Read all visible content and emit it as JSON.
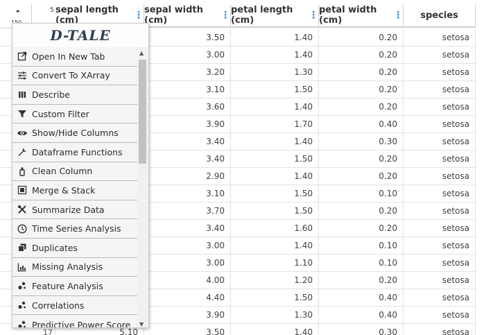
{
  "corner": {
    "play": "►",
    "cols": "5",
    "rows": "150"
  },
  "columns": [
    "sepal length (cm)",
    "sepal width (cm)",
    "petal length (cm)",
    "petal width (cm)",
    "species"
  ],
  "rows": [
    [
      "",
      "3.50",
      "1.40",
      "0.20",
      "setosa"
    ],
    [
      "",
      "3.00",
      "1.40",
      "0.20",
      "setosa"
    ],
    [
      "",
      "3.20",
      "1.30",
      "0.20",
      "setosa"
    ],
    [
      "",
      "3.10",
      "1.50",
      "0.20",
      "setosa"
    ],
    [
      "",
      "3.60",
      "1.40",
      "0.20",
      "setosa"
    ],
    [
      "",
      "3.90",
      "1.70",
      "0.40",
      "setosa"
    ],
    [
      "",
      "3.40",
      "1.40",
      "0.30",
      "setosa"
    ],
    [
      "",
      "3.40",
      "1.50",
      "0.20",
      "setosa"
    ],
    [
      "",
      "2.90",
      "1.40",
      "0.20",
      "setosa"
    ],
    [
      "",
      "3.10",
      "1.50",
      "0.10",
      "setosa"
    ],
    [
      "",
      "3.70",
      "1.50",
      "0.20",
      "setosa"
    ],
    [
      "",
      "3.40",
      "1.60",
      "0.20",
      "setosa"
    ],
    [
      "",
      "3.00",
      "1.40",
      "0.10",
      "setosa"
    ],
    [
      "",
      "3.00",
      "1.10",
      "0.10",
      "setosa"
    ],
    [
      "",
      "4.00",
      "1.20",
      "0.20",
      "setosa"
    ],
    [
      "",
      "4.40",
      "1.50",
      "0.40",
      "setosa"
    ],
    [
      "",
      "3.90",
      "1.30",
      "0.40",
      "setosa"
    ],
    [
      "5.10",
      "3.50",
      "1.40",
      "0.30",
      "setosa"
    ]
  ],
  "last_row_index": "17",
  "menu": {
    "logo": "D-TALE",
    "items": [
      {
        "label": "Open In New Tab",
        "icon": "external-link-icon"
      },
      {
        "label": "Convert To XArray",
        "icon": "sliders-icon"
      },
      {
        "label": "Describe",
        "icon": "bars-icon"
      },
      {
        "label": "Custom Filter",
        "icon": "filter-icon"
      },
      {
        "label": "Show/Hide Columns",
        "icon": "eye-icon"
      },
      {
        "label": "Dataframe Functions",
        "icon": "wrench-icon"
      },
      {
        "label": "Clean Column",
        "icon": "clean-icon"
      },
      {
        "label": "Merge & Stack",
        "icon": "merge-icon"
      },
      {
        "label": "Summarize Data",
        "icon": "tools-icon"
      },
      {
        "label": "Time Series Analysis",
        "icon": "clock-icon"
      },
      {
        "label": "Duplicates",
        "icon": "copy-icon"
      },
      {
        "label": "Missing Analysis",
        "icon": "chart-icon"
      },
      {
        "label": "Feature Analysis",
        "icon": "scatter-icon"
      },
      {
        "label": "Correlations",
        "icon": "scatter-icon"
      },
      {
        "label": "Predictive Power Score",
        "icon": "scatter-icon"
      }
    ]
  }
}
